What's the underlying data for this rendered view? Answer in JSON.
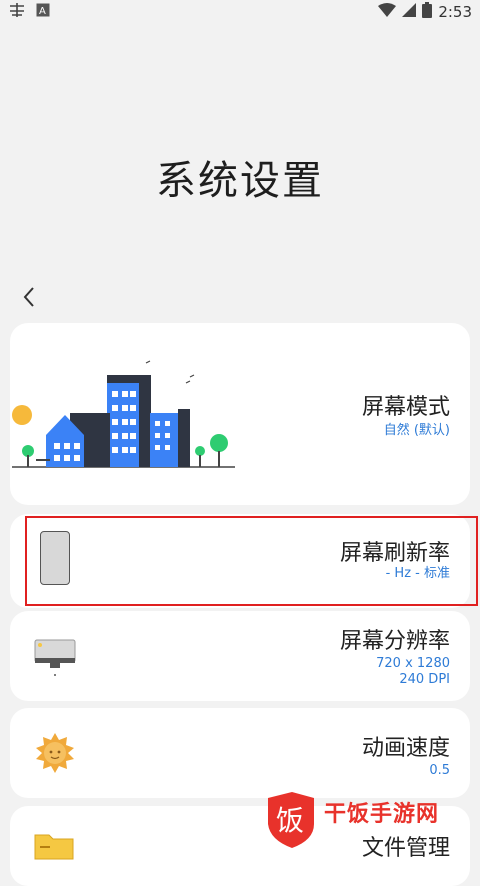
{
  "status_bar": {
    "time": "2:53",
    "left_icons": [
      "notification-icon",
      "font-icon"
    ],
    "right_icons": [
      "wifi-icon",
      "signal-icon",
      "battery-icon"
    ]
  },
  "page": {
    "title": "系统设置"
  },
  "settings": [
    {
      "key": "screen_mode",
      "label": "屏幕模式",
      "value": "自然 (默认)",
      "icon": "city-illustration-icon"
    },
    {
      "key": "refresh_rate",
      "label": "屏幕刷新率",
      "value": "- Hz - 标准",
      "icon": "phone-icon"
    },
    {
      "key": "resolution",
      "label": "屏幕分辨率",
      "value_line1": "720 x 1280",
      "value_line2": "240 DPI",
      "icon": "monitor-icon"
    },
    {
      "key": "animation_speed",
      "label": "动画速度",
      "value": "0.5",
      "icon": "sun-icon"
    },
    {
      "key": "file_manager",
      "label": "文件管理",
      "icon": "folder-icon"
    }
  ],
  "watermark": {
    "text": "干饭手游网"
  },
  "colors": {
    "accent": "#2e7bd6",
    "highlight": "#e02020",
    "background": "#f2f2f2"
  }
}
